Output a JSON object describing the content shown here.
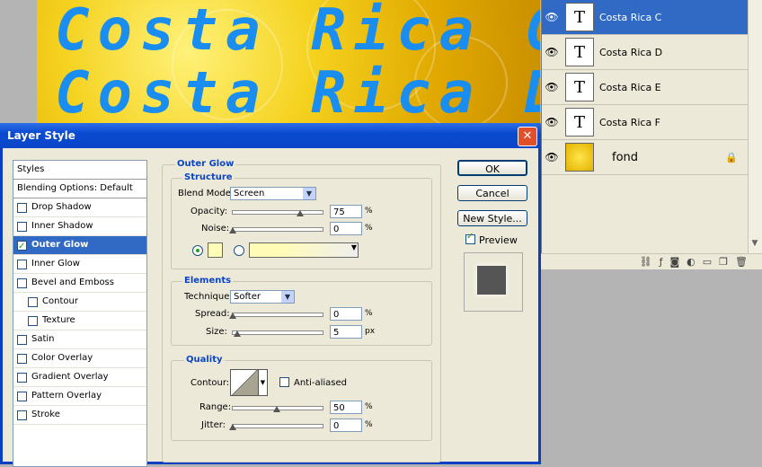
{
  "canvas": {
    "line1": "Costa Rica C",
    "line2": "Costa Rica D"
  },
  "layers": [
    {
      "name": "Costa Rica C",
      "thumb": "T",
      "selected": true
    },
    {
      "name": "Costa Rica D",
      "thumb": "T",
      "selected": false
    },
    {
      "name": "Costa Rica E",
      "thumb": "T",
      "selected": false
    },
    {
      "name": "Costa Rica F",
      "thumb": "T",
      "selected": false
    },
    {
      "name": "fond",
      "thumb": "",
      "selected": false,
      "locked": true
    }
  ],
  "dialog": {
    "title": "Layer Style",
    "close": "✕",
    "styles_header": "Styles",
    "blending": "Blending Options: Default",
    "style_items": [
      {
        "label": "Drop Shadow",
        "checked": false
      },
      {
        "label": "Inner Shadow",
        "checked": false
      },
      {
        "label": "Outer Glow",
        "checked": true,
        "selected": true
      },
      {
        "label": "Inner Glow",
        "checked": false
      },
      {
        "label": "Bevel and Emboss",
        "checked": false
      },
      {
        "label": "Contour",
        "checked": false
      },
      {
        "label": "Texture",
        "checked": false
      },
      {
        "label": "Satin",
        "checked": false
      },
      {
        "label": "Color Overlay",
        "checked": false
      },
      {
        "label": "Gradient Overlay",
        "checked": false
      },
      {
        "label": "Pattern Overlay",
        "checked": false
      },
      {
        "label": "Stroke",
        "checked": false
      }
    ],
    "section_title": "Outer Glow",
    "structure": {
      "title": "Structure",
      "blend_label": "Blend Mode:",
      "blend_value": "Screen",
      "opacity_label": "Opacity:",
      "opacity_value": "75",
      "opacity_unit": "%",
      "noise_label": "Noise:",
      "noise_value": "0",
      "noise_unit": "%"
    },
    "elements": {
      "title": "Elements",
      "technique_label": "Technique:",
      "technique_value": "Softer",
      "spread_label": "Spread:",
      "spread_value": "0",
      "spread_unit": "%",
      "size_label": "Size:",
      "size_value": "5",
      "size_unit": "px"
    },
    "quality": {
      "title": "Quality",
      "contour_label": "Contour:",
      "antialiased_label": "Anti-aliased",
      "range_label": "Range:",
      "range_value": "50",
      "range_unit": "%",
      "jitter_label": "Jitter:",
      "jitter_value": "0",
      "jitter_unit": "%"
    },
    "buttons": {
      "ok": "OK",
      "cancel": "Cancel",
      "new_style": "New Style...",
      "preview": "Preview"
    }
  },
  "colors": {
    "accent": "#316ac5",
    "title_blue": "#0a4ad0",
    "glow": "#fffcb8"
  },
  "slider_levels": {
    "opacity": 0.75,
    "noise": 0.0,
    "spread": 0.0,
    "size": 0.05,
    "range": 0.5,
    "jitter": 0.0
  }
}
